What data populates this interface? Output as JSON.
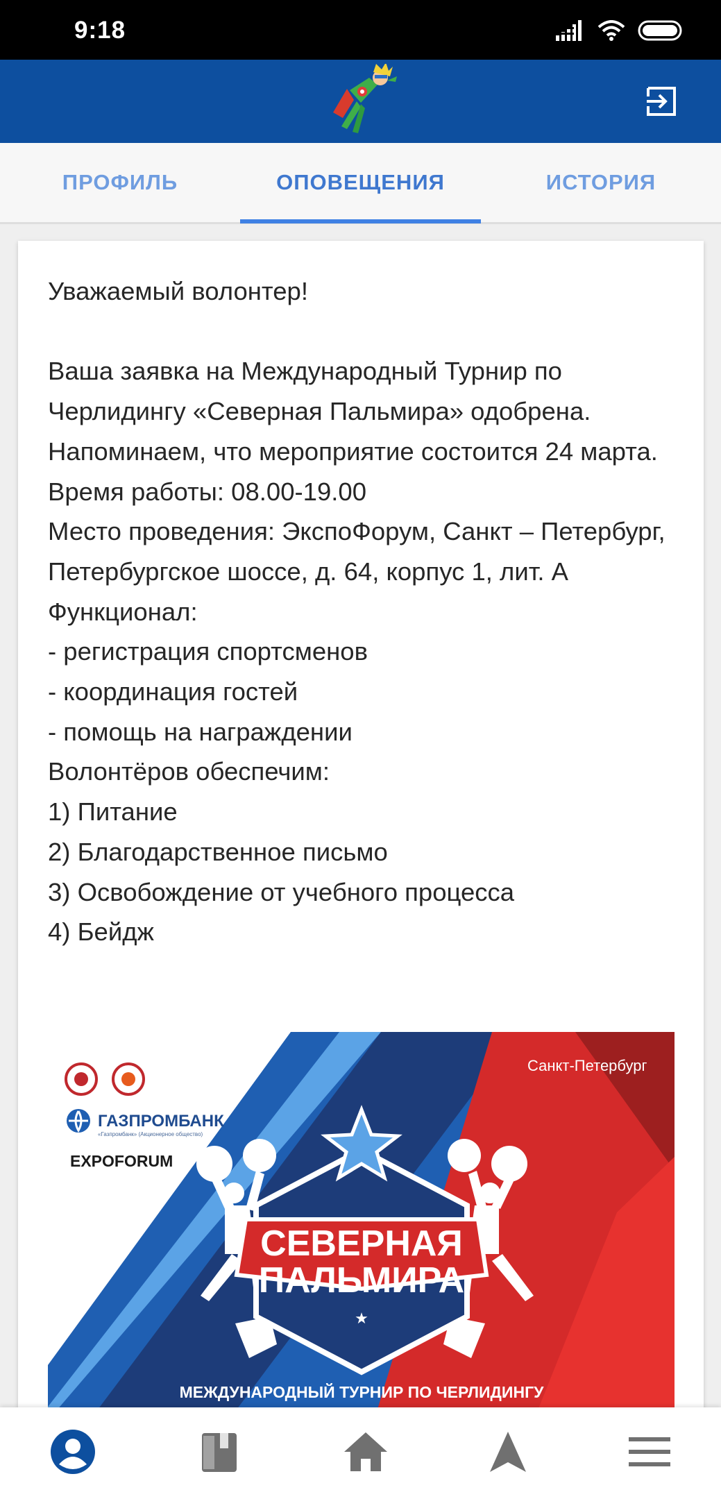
{
  "status_bar": {
    "time": "9:18"
  },
  "header": {
    "logo_icon": "superhero-mascot-logo",
    "logout_icon": "logout-icon"
  },
  "tabs": [
    {
      "label": "ПРОФИЛЬ",
      "active": false
    },
    {
      "label": "ОПОВЕЩЕНИЯ",
      "active": true
    },
    {
      "label": "ИСТОРИЯ",
      "active": false
    }
  ],
  "notification": {
    "greeting": "Уважаемый волонтер!",
    "lines": [
      "Ваша заявка на Международный Турнир по Черлидингу «Северная Пальмира» одобрена.",
      "Напоминаем, что мероприятие состоится 24 марта.",
      "Время работы: 08.00-19.00",
      "Место проведения: ЭкспоФорум, Санкт – Петербург, Петербургское шоссе, д. 64, корпус 1, лит. А",
      "Функционал:",
      "- регистрация спортсменов",
      "- координация гостей",
      "- помощь на награждении",
      "Волонтёров обеспечим:",
      "1) Питание",
      "2) Благодарственное письмо",
      "3) Освобождение от учебного процесса",
      "4) Бейдж"
    ],
    "banner": {
      "city": "Санкт-Петербург",
      "sponsor_gazprom": "ГАЗПРОМБАНК",
      "sponsor_gazprom_sub": "«Газпромбанк» (Акционерное общество)",
      "sponsor_expo": "EXPOFORUM",
      "title_line1": "СЕВЕРНАЯ",
      "title_line2": "ПАЛЬМИРА",
      "subtitle": "МЕЖДУНАРОДНЫЙ ТУРНИР ПО ЧЕРЛИДИНГУ",
      "colors": {
        "blue": "#1f5fb2",
        "red": "#d42a2a",
        "navy": "#1d3c79"
      }
    }
  },
  "bottom_nav": [
    {
      "icon": "account-circle-icon",
      "active": true
    },
    {
      "icon": "book-icon",
      "active": false
    },
    {
      "icon": "home-icon",
      "active": false
    },
    {
      "icon": "navigation-arrow-icon",
      "active": false
    },
    {
      "icon": "menu-icon",
      "active": false
    }
  ],
  "colors": {
    "app_bar": "#0d4f9f",
    "tab_text": "#6f9de0",
    "tab_active": "#3f78cf",
    "indicator": "#3f81e4",
    "nav_active": "#0d4f9f",
    "nav_inactive": "#707070"
  }
}
